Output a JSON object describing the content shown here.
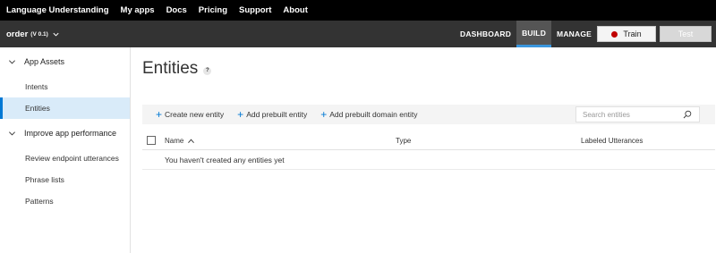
{
  "topnav": {
    "items": [
      "Language Understanding",
      "My apps",
      "Docs",
      "Pricing",
      "Support",
      "About"
    ]
  },
  "appbar": {
    "app_name": "order",
    "version": "(V 0.1)",
    "tabs": [
      "DASHBOARD",
      "BUILD",
      "MANAGE"
    ],
    "active_tab": "BUILD",
    "train_label": "Train",
    "test_label": "Test",
    "train_status_color": "#c00000",
    "accent_color": "#3a96dd"
  },
  "sidebar": {
    "groups": [
      {
        "label": "App Assets",
        "icon": "chevron-down-icon",
        "items": [
          "Intents",
          "Entities"
        ]
      },
      {
        "label": "Improve app performance",
        "icon": "chevron-down-icon",
        "items": [
          "Review endpoint utterances",
          "Phrase lists",
          "Patterns"
        ]
      }
    ],
    "active_item": "Entities"
  },
  "main": {
    "title": "Entities",
    "help_glyph": "?",
    "toolbar": {
      "buttons": [
        "Create new entity",
        "Add prebuilt entity",
        "Add prebuilt domain entity"
      ],
      "button_icon": "plus-icon",
      "search_placeholder": "Search entities",
      "search_icon": "search-icon"
    },
    "table": {
      "columns": [
        "Name",
        "Type",
        "Labeled Utterances"
      ],
      "sort_column": "Name",
      "sort_direction": "ascending",
      "empty_message": "You haven't created any entities yet"
    }
  }
}
